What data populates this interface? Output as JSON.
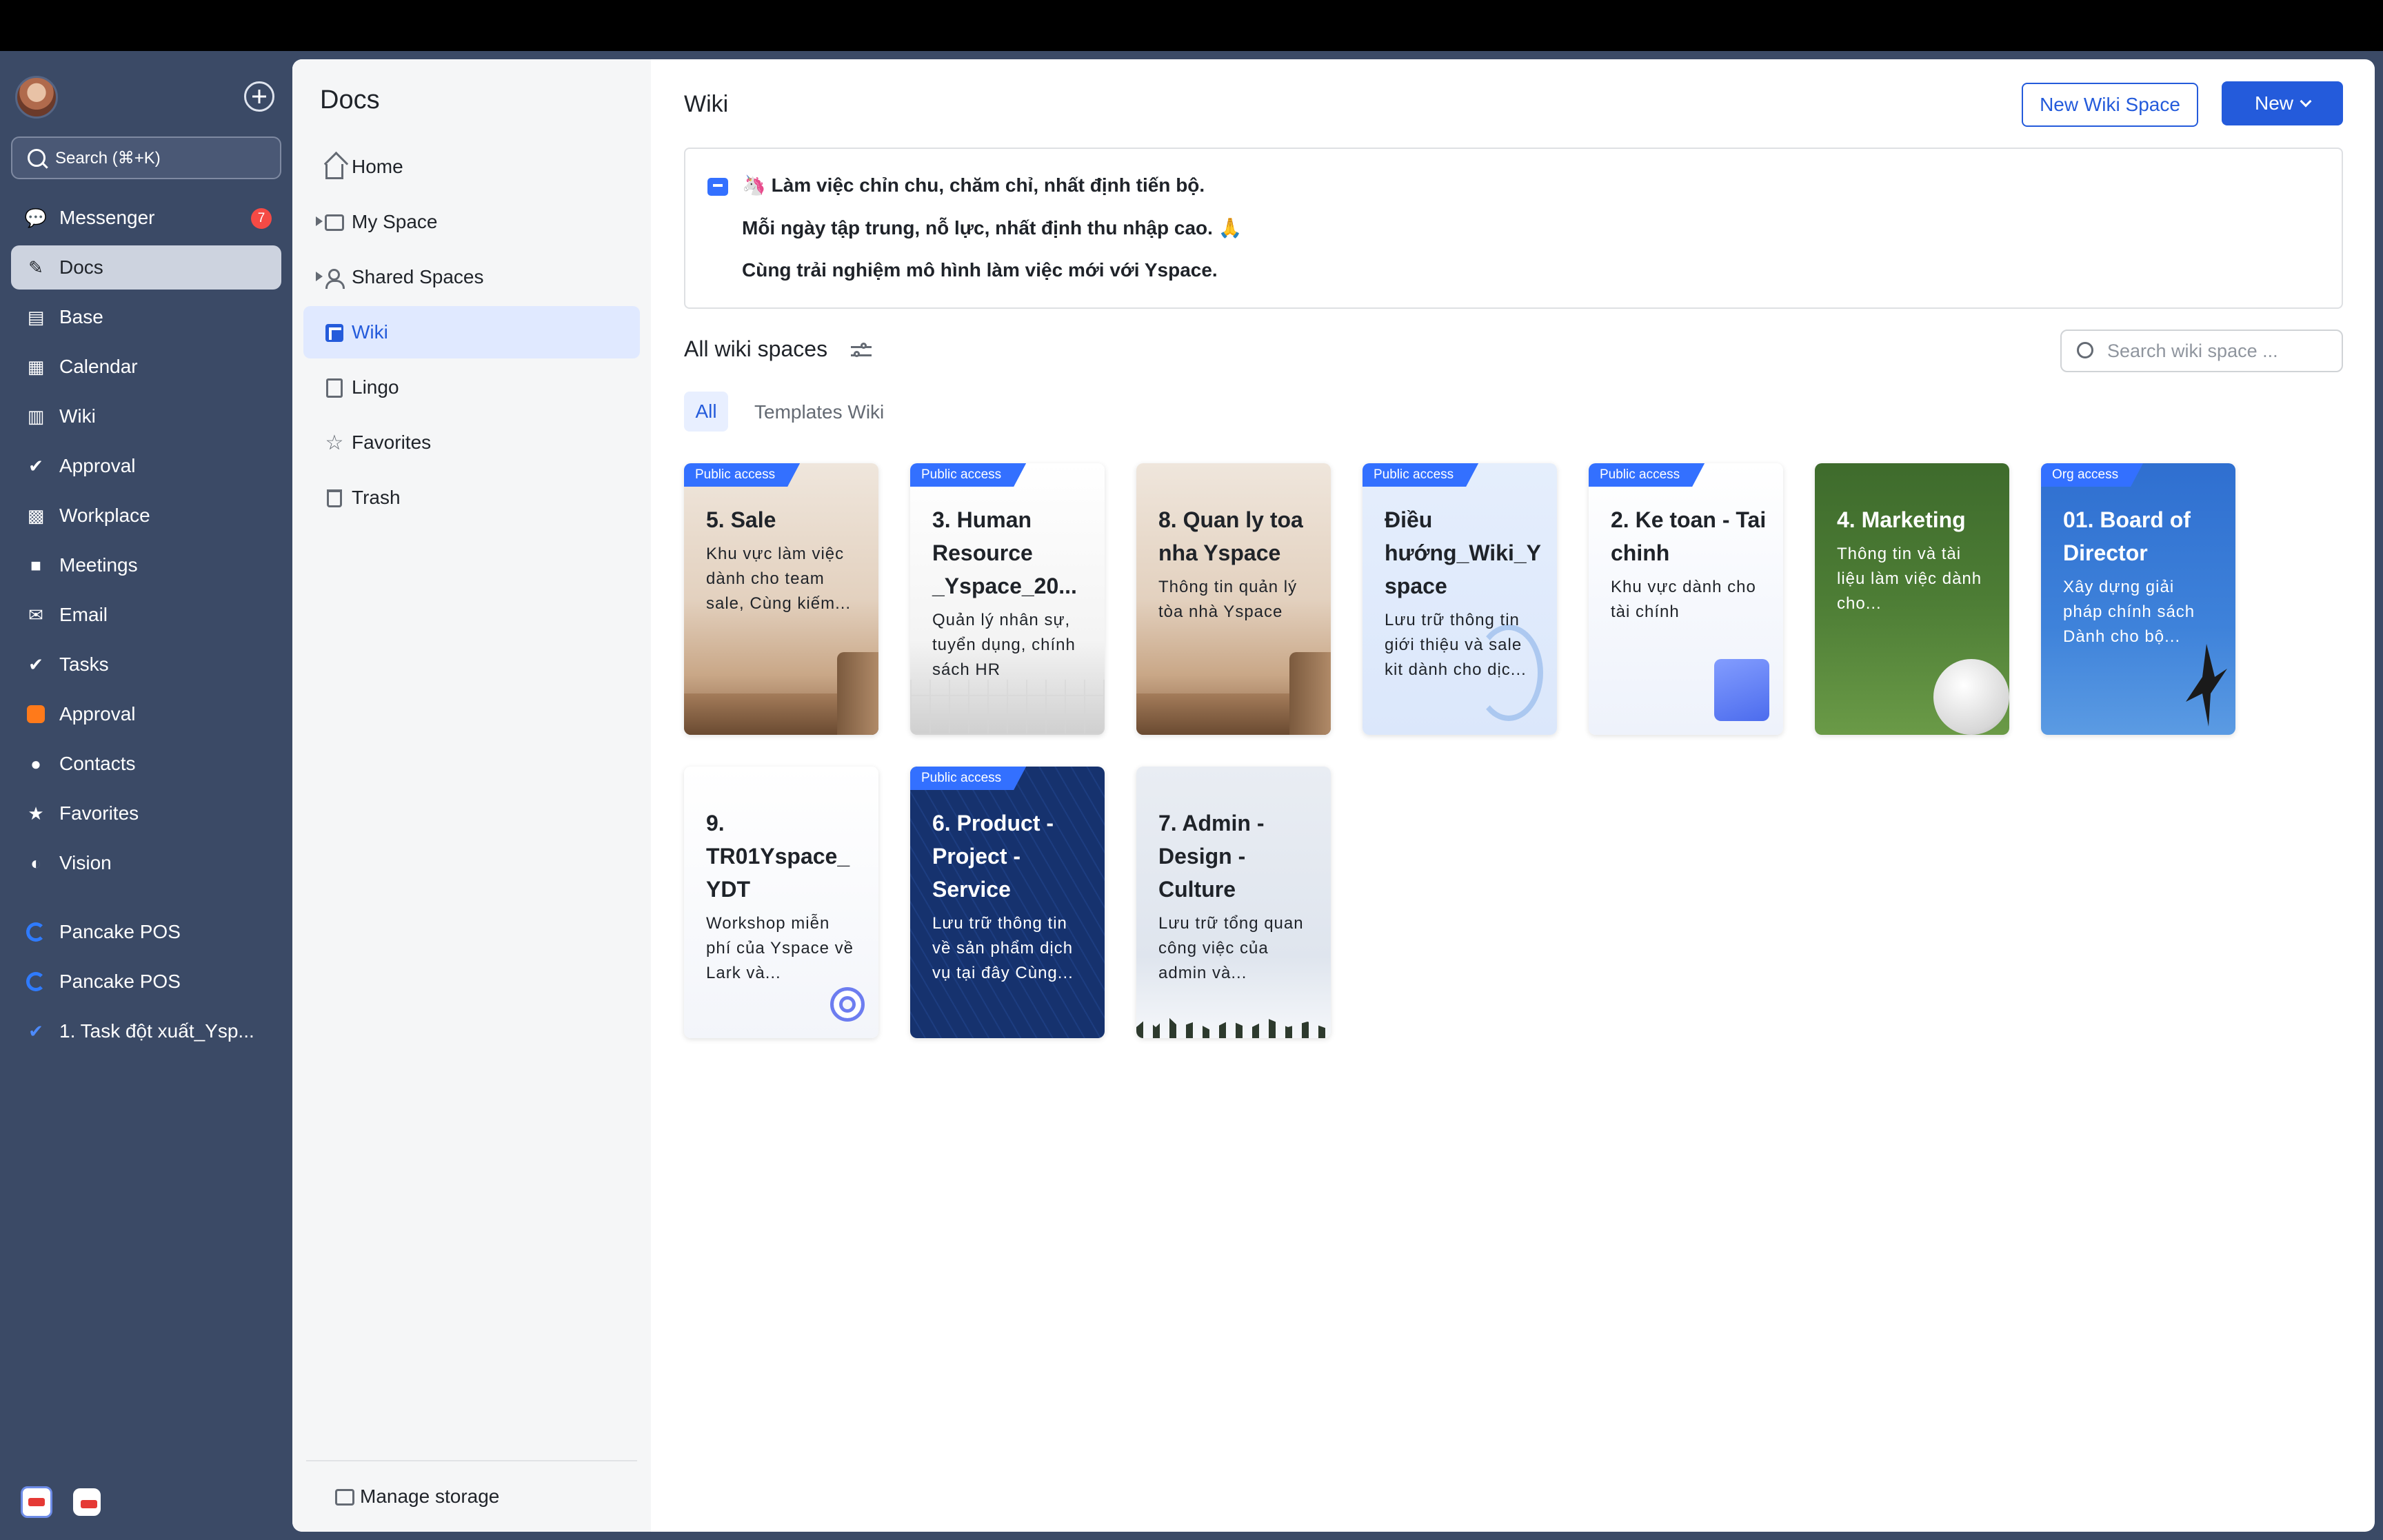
{
  "sidebar": {
    "search_label": "Search (⌘+K)",
    "items": [
      {
        "label": "Messenger",
        "badge": "7"
      },
      {
        "label": "Docs"
      },
      {
        "label": "Base"
      },
      {
        "label": "Calendar"
      },
      {
        "label": "Wiki"
      },
      {
        "label": "Approval"
      },
      {
        "label": "Workplace"
      },
      {
        "label": "Meetings"
      },
      {
        "label": "Email"
      },
      {
        "label": "Tasks"
      },
      {
        "label": "Approval"
      },
      {
        "label": "Contacts"
      },
      {
        "label": "Favorites"
      },
      {
        "label": "Vision"
      }
    ],
    "pinned": [
      {
        "label": "Pancake POS"
      },
      {
        "label": "Pancake POS"
      },
      {
        "label": "1. Task đột xuất_Ysp..."
      }
    ]
  },
  "docs_nav": {
    "title": "Docs",
    "items": [
      {
        "label": "Home"
      },
      {
        "label": "My Space"
      },
      {
        "label": "Shared Spaces"
      },
      {
        "label": "Wiki"
      },
      {
        "label": "Lingo"
      },
      {
        "label": "Favorites"
      },
      {
        "label": "Trash"
      }
    ],
    "manage_storage": "Manage storage"
  },
  "main": {
    "title": "Wiki",
    "new_wiki_space_button": "New Wiki Space",
    "new_button": "New",
    "announcement": {
      "line1": "🦄 Làm việc chỉn chu, chăm chỉ, nhất định tiến bộ.",
      "line2": "Mỗi ngày tập trung, nỗ lực, nhất định thu nhập cao. 🙏",
      "line3": "Cùng trải nghiệm mô hình làm việc mới với Yspace."
    },
    "section_title": "All wiki spaces",
    "search_placeholder": "Search wiki space ...",
    "tabs": {
      "all": "All",
      "templates": "Templates Wiki"
    },
    "cards": [
      {
        "tag": "Public access",
        "title": "5. Sale",
        "desc": "Khu vực làm việc dành cho team sale, Cùng kiếm..."
      },
      {
        "tag": "Public access",
        "title": "3. Human Resource _Yspace_20...",
        "desc": "Quản lý nhân sự, tuyển dụng, chính sách HR"
      },
      {
        "tag": "",
        "title": "8. Quan ly toa nha Yspace",
        "desc": "Thông tin quản lý tòa nhà Yspace"
      },
      {
        "tag": "Public access",
        "title": "Điều hướng_Wiki_Y space",
        "desc": "Lưu trữ thông tin giới thiệu và sale kit dành cho dịc..."
      },
      {
        "tag": "Public access",
        "title": "2. Ke toan - Tai chinh",
        "desc": "Khu vực dành cho tài chính"
      },
      {
        "tag": "",
        "title": "4. Marketing",
        "desc": "Thông tin và tài liệu làm việc dành cho..."
      },
      {
        "tag": "Org access",
        "title": "01. Board of Director",
        "desc": "Xây dựng giải pháp chính sách Dành cho bộ..."
      },
      {
        "tag": "",
        "title": "9. TR01Yspace_ YDT",
        "desc": "Workshop miễn phí của Yspace về Lark và..."
      },
      {
        "tag": "Public access",
        "title": "6. Product - Project - Service",
        "desc": "Lưu trữ thông tin về sản phẩm dịch vụ tại đây Cùng..."
      },
      {
        "tag": "",
        "title": "7. Admin - Design - Culture",
        "desc": "Lưu trữ tổng quan công việc của admin và..."
      }
    ]
  }
}
